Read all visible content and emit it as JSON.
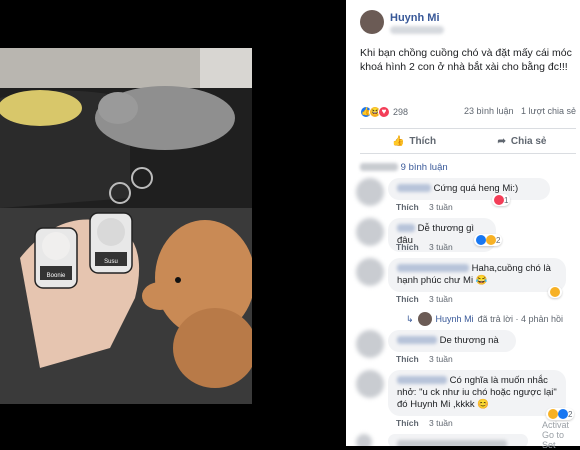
{
  "post": {
    "author": "Huynh Mi",
    "caption": "Khi bạn chồng cuồng chó và đặt mấy cái móc khoá hình 2 con ở nhà bắt xài cho bằng đc!!!",
    "reaction_count": "298",
    "comment_count": "23 bình luận",
    "share_count": "1 lượt chia sẻ",
    "like_label": "Thích",
    "share_label": "Chia sẻ"
  },
  "photo": {
    "tag_left": "Boonie",
    "tag_right": "Susu"
  },
  "comments_section": {
    "previous": "9 bình luận"
  },
  "comments": [
    {
      "name": "Thuy Hoa",
      "text": "Cứng quá heng Mi:)",
      "like": "Thích",
      "time": "3 tuần",
      "reaction_count": "1"
    },
    {
      "name": "",
      "text": "Dễ thương gì đâu",
      "like": "Thích",
      "time": "3 tuần",
      "reaction_count": "2"
    },
    {
      "name": "Nguyễn Kim Nhung",
      "text": "Haha,cuồng chó là hạnh phúc chư Mi 😂",
      "like": "Thích",
      "time": "3 tuần",
      "reaction_count": ""
    },
    {
      "name": "",
      "text": "De thương nà",
      "like": "Thích",
      "time": "3 tuần",
      "reaction_count": ""
    },
    {
      "name": "Thuy Hoa Van",
      "text": "Có nghĩa là muốn nhắc nhở: \"u ck như iu chó hoặc ngược lại\" đó Huynh Mi ,kkkk 😊",
      "like": "Thích",
      "time": "3 tuần",
      "reaction_count": "2"
    }
  ],
  "reply": {
    "author": "Huynh Mi",
    "text": "đã trả lời · 4 phản hồi"
  },
  "watermark": {
    "line1": "Activat",
    "line2": "Go to Set"
  },
  "colors": {
    "link": "#385898",
    "like_blue": "#1877f2",
    "haha_yellow": "#f7b125",
    "love_red": "#f33e58"
  }
}
